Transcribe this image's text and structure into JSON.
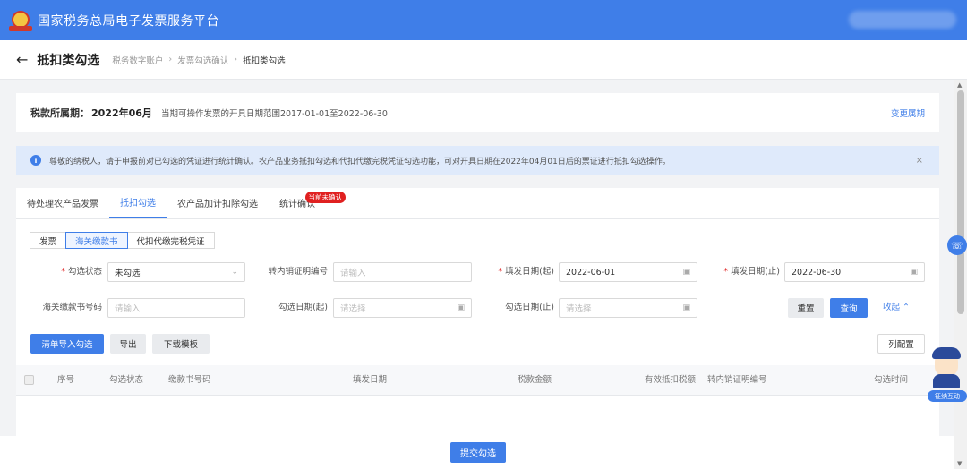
{
  "app": {
    "title": "国家税务总局电子发票服务平台"
  },
  "page": {
    "title": "抵扣类勾选",
    "breadcrumbs": [
      "税务数字账户",
      "发票勾选确认",
      "抵扣类勾选"
    ]
  },
  "period": {
    "label": "税款所属期：",
    "value": "2022年06月",
    "range_text": "当期可操作发票的开具日期范围2017-01-01至2022-06-30",
    "change_link": "变更属期"
  },
  "notice": {
    "text": "尊敬的纳税人，请于申报前对已勾选的凭证进行统计确认。农产品业务抵扣勾选和代扣代缴完税凭证勾选功能，可对开具日期在2022年04月01日后的票证进行抵扣勾选操作。",
    "close": "×"
  },
  "tabs": [
    {
      "label": "待处理农产品发票"
    },
    {
      "label": "抵扣勾选"
    },
    {
      "label": "农产品加计扣除勾选"
    },
    {
      "label": "统计确认",
      "badge": "当前未确认"
    }
  ],
  "subtabs": [
    "发票",
    "海关缴款书",
    "代扣代缴完税凭证"
  ],
  "filters": {
    "status": {
      "label": "勾选状态",
      "value": "未勾选"
    },
    "transfer_no": {
      "label": "转内销证明编号",
      "placeholder": "请输入"
    },
    "issue_start": {
      "label": "填发日期(起)",
      "value": "2022-06-01"
    },
    "issue_end": {
      "label": "填发日期(止)",
      "value": "2022-06-30"
    },
    "customs_no": {
      "label": "海关缴款书号码",
      "placeholder": "请输入"
    },
    "select_start": {
      "label": "勾选日期(起)",
      "placeholder": "请选择"
    },
    "select_end": {
      "label": "勾选日期(止)",
      "placeholder": "请选择"
    }
  },
  "actions": {
    "reset": "重置",
    "query": "查询",
    "collapse": "收起",
    "import": "清单导入勾选",
    "export": "导出",
    "download": "下载模板",
    "columns": "列配置",
    "submit": "提交勾选"
  },
  "table": {
    "columns": [
      "序号",
      "勾选状态",
      "缴款书号码",
      "填发日期",
      "税款金额",
      "有效抵扣税额",
      "转内销证明编号",
      "勾选时间"
    ]
  },
  "assistant": {
    "label": "征纳互动"
  },
  "icons": {
    "back": "arrow-left-icon",
    "info": "info-icon",
    "calendar": "calendar-icon",
    "headset": "headset-icon"
  },
  "colors": {
    "primary": "#3f7ee8",
    "badge": "#e02020",
    "notice_bg": "#dfeafb"
  }
}
